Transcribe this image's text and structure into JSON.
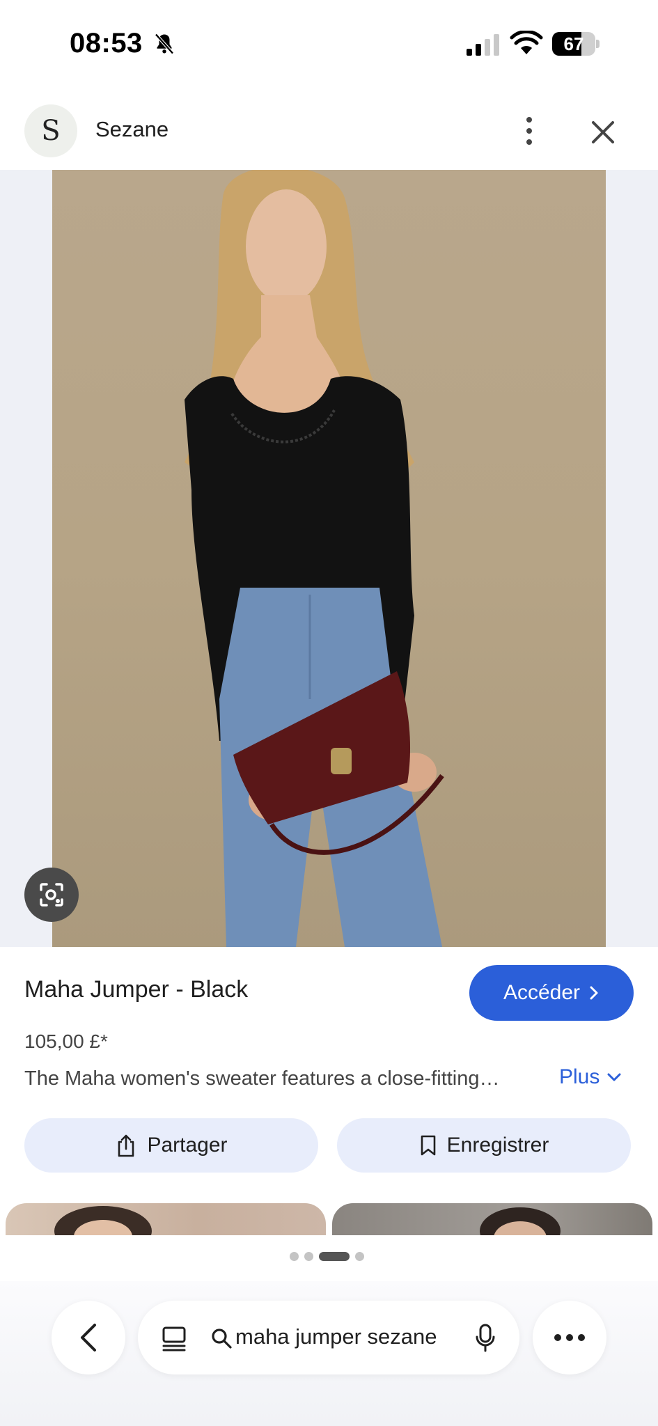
{
  "status_bar": {
    "time": "08:53",
    "battery": "67",
    "battery_level": 0.67
  },
  "header": {
    "logo_letter": "S",
    "site_name": "Sezane"
  },
  "product": {
    "title": "Maha Jumper - Black",
    "price": "105,00 £*",
    "description": "The Maha women's sweater features a close-fitting…",
    "more_label": "Plus",
    "visit_label": "Accéder"
  },
  "actions": {
    "share_label": "Partager",
    "save_label": "Enregistrer"
  },
  "carousel": {
    "dot_count": 4,
    "active_index": 2
  },
  "bottom_bar": {
    "search_query": "maha jumper sezane"
  },
  "colors": {
    "accent": "#2b5fd9",
    "pill_bg": "#e8edfb"
  },
  "icons": [
    "bell-slash-icon",
    "signal-icon",
    "wifi-icon",
    "battery-icon",
    "more-vert-icon",
    "close-icon",
    "lens-icon",
    "chevron-right-icon",
    "chevron-down-icon",
    "share-icon",
    "bookmark-icon",
    "chevron-left-icon",
    "tabs-icon",
    "search-icon",
    "mic-icon",
    "more-horiz-icon"
  ]
}
